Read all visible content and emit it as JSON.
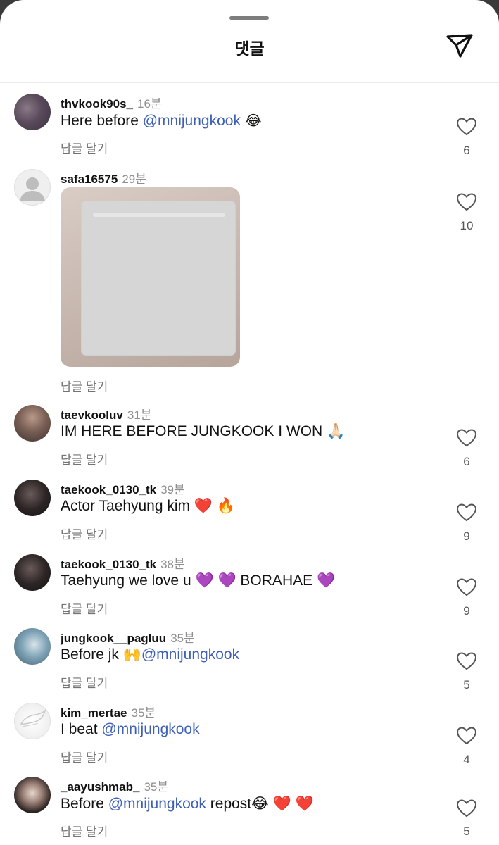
{
  "header": {
    "title": "댓글",
    "send_icon": "paper-plane-icon"
  },
  "reply_label": "답글 달기",
  "colors": {
    "mention": "#3e5fb8",
    "muted": "#8e8e8e",
    "background": "#ffffff"
  },
  "comments": [
    {
      "username": "thvkook90s_",
      "time": "16분",
      "text_parts": [
        "Here before ",
        "@mnijungkook",
        " 😂"
      ],
      "likes": "6"
    },
    {
      "username": "safa16575",
      "time": "29분",
      "attachment": "image",
      "likes": "10"
    },
    {
      "username": "taevkooluv",
      "time": "31분",
      "text_parts": [
        "IM HERE BEFORE JUNGKOOK I WON 🙏🏻"
      ],
      "likes": "6"
    },
    {
      "username": "taekook_0130_tk",
      "time": "39분",
      "text_parts": [
        "Actor Taehyung kim ❤️ 🔥"
      ],
      "likes": "9"
    },
    {
      "username": "taekook_0130_tk",
      "time": "38분",
      "text_parts": [
        "Taehyung we love u 💜 💜 BORAHAE 💜"
      ],
      "likes": "9"
    },
    {
      "username": "jungkook__pagluu",
      "time": "35분",
      "text_parts": [
        "Before jk 🙌",
        "@mnijungkook"
      ],
      "likes": "5"
    },
    {
      "username": "kim_mertae",
      "time": "35분",
      "text_parts": [
        "I beat ",
        "@mnijungkook"
      ],
      "likes": "4"
    },
    {
      "username": "_aayushmab_",
      "time": "35분",
      "text_parts": [
        "Before ",
        "@mnijungkook",
        " repost😂 ❤️ ❤️"
      ],
      "likes": "5"
    }
  ]
}
